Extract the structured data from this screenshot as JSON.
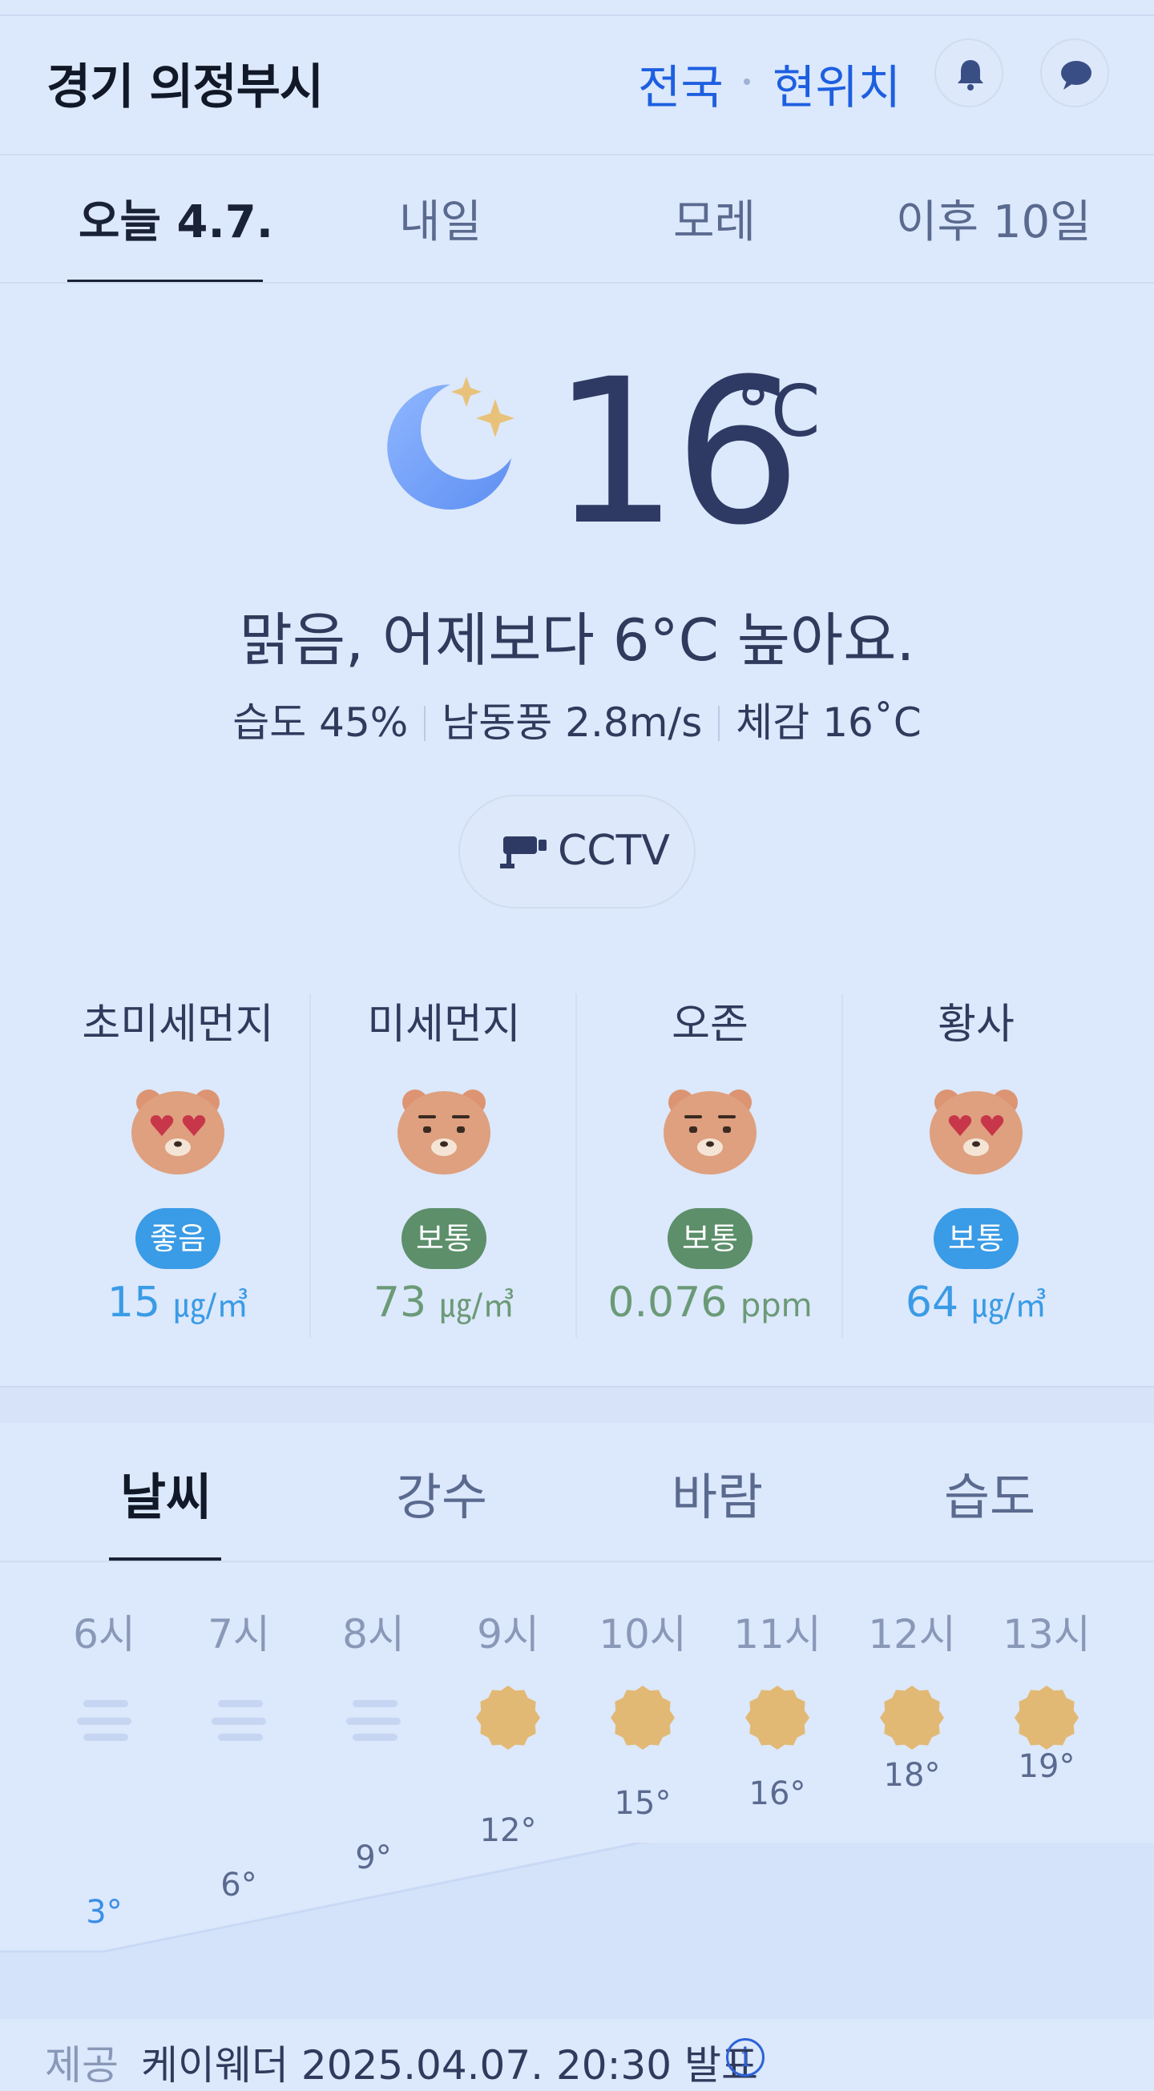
{
  "header": {
    "location": "경기 의정부시",
    "national_link": "전국",
    "current_location_link": "현위치",
    "bell_icon": "bell-icon",
    "chat_icon": "chat-bubble-icon"
  },
  "day_tabs": [
    {
      "label": "오늘 4.7.",
      "active": true
    },
    {
      "label": "내일",
      "active": false
    },
    {
      "label": "모레",
      "active": false
    },
    {
      "label": "이후 10일",
      "active": false
    }
  ],
  "current": {
    "icon": "clear-night-moon-icon",
    "temperature": "16",
    "unit": "°C",
    "summary": "맑음, 어제보다 6°C 높아요.",
    "humidity": "습도 45%",
    "wind": "남동풍 2.8m/s",
    "feels_like": "체감 16˚C",
    "cctv_label": "CCTV"
  },
  "air_quality": [
    {
      "label": "초미세먼지",
      "face": "heart-eyes-bear-icon",
      "status": "좋음",
      "value": "15",
      "unit": "㎍/㎥",
      "color": "#3a9be6"
    },
    {
      "label": "미세먼지",
      "face": "neutral-bear-icon",
      "status": "보통",
      "value": "73",
      "unit": "㎍/㎥",
      "color": "#5c8f6a"
    },
    {
      "label": "오존",
      "face": "neutral-bear-icon",
      "status": "보통",
      "value": "0.076",
      "unit": "ppm",
      "color": "#5c8f6a"
    },
    {
      "label": "황사",
      "face": "heart-eyes-bear-icon",
      "status": "보통",
      "value": "64",
      "unit": "㎍/㎥",
      "color": "#3a9be6"
    }
  ],
  "bottom_tabs": [
    {
      "label": "날씨",
      "active": true
    },
    {
      "label": "강수",
      "active": false
    },
    {
      "label": "바람",
      "active": false
    },
    {
      "label": "습도",
      "active": false
    }
  ],
  "hourly": [
    {
      "hour": "6시",
      "icon": "fog-icon",
      "temp": "3°"
    },
    {
      "hour": "7시",
      "icon": "fog-icon",
      "temp": "6°"
    },
    {
      "hour": "8시",
      "icon": "fog-icon",
      "temp": "9°"
    },
    {
      "hour": "9시",
      "icon": "sun-icon",
      "temp": "12°"
    },
    {
      "hour": "10시",
      "icon": "sun-icon",
      "temp": "15°"
    },
    {
      "hour": "11시",
      "icon": "sun-icon",
      "temp": "16°"
    },
    {
      "hour": "12시",
      "icon": "sun-icon",
      "temp": "18°"
    },
    {
      "hour": "13시",
      "icon": "sun-icon",
      "temp": "19°"
    }
  ],
  "footer": {
    "source_label": "제공",
    "source_text": "케이웨더 2025.04.07. 20:30 발표",
    "info_icon": "info-icon",
    "info_glyph": "i"
  },
  "colors": {
    "background": "#dce8fb",
    "link_blue": "#1d5fe0",
    "good_blue": "#3a9be6",
    "normal_green": "#5c8f6a",
    "sun_yellow": "#e2b974"
  }
}
